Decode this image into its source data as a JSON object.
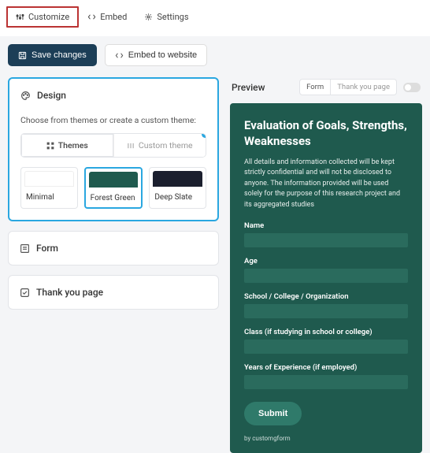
{
  "tabs": {
    "customize": "Customize",
    "embed": "Embed",
    "settings": "Settings"
  },
  "actions": {
    "save": "Save changes",
    "embed": "Embed to website"
  },
  "design": {
    "title": "Design",
    "hint": "Choose from themes or create a custom theme:",
    "seg_themes": "Themes",
    "seg_custom": "Custom theme",
    "themes": [
      {
        "label": "Minimal",
        "color": "#ffffff"
      },
      {
        "label": "Forest Green",
        "color": "#1f5a4e"
      },
      {
        "label": "Deep Slate",
        "color": "#1b1f2e"
      }
    ]
  },
  "form_card": "Form",
  "thankyou_card": "Thank you page",
  "preview": {
    "title": "Preview",
    "tab_form": "Form",
    "tab_thankyou": "Thank you page"
  },
  "form": {
    "title": "Evaluation of Goals, Strengths, Weaknesses",
    "desc": "All details and information collected will be kept strictly confidential and will not be disclosed to anyone. The information provided will be used solely for the purpose of this research project and its aggregated studies",
    "fields": {
      "name": "Name",
      "age": "Age",
      "school": "School / College / Organization",
      "class": "Class (if studying in school or college)",
      "years": "Years of Experience (if employed)"
    },
    "submit": "Submit",
    "credit": "by customgform"
  }
}
